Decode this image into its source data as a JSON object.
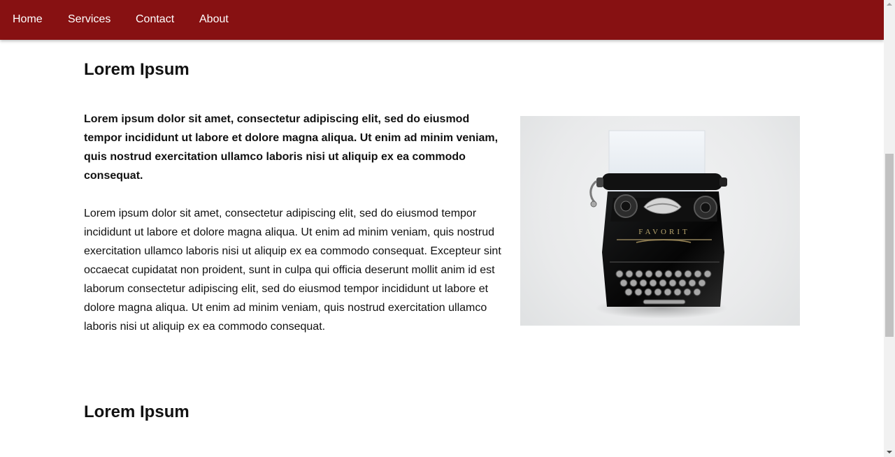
{
  "nav": {
    "items": [
      {
        "label": "Home"
      },
      {
        "label": "Services"
      },
      {
        "label": "Contact"
      },
      {
        "label": "About"
      }
    ],
    "background": "#871112"
  },
  "sections": [
    {
      "heading": "Lorem Ipsum",
      "intro": "Lorem ipsum dolor sit amet, consectetur adipiscing elit, sed do eiusmod tempor incididunt ut labore et dolore magna aliqua. Ut enim ad minim veniam, quis nostrud exercitation ullamco laboris nisi ut aliquip ex ea commodo consequat.",
      "body": "Lorem ipsum dolor sit amet, consectetur adipiscing elit, sed do eiusmod tempor incididunt ut labore et dolore magna aliqua. Ut enim ad minim veniam, quis nostrud exercitation ullamco laboris nisi ut aliquip ex ea commodo consequat. Excepteur sint occaecat cupidatat non proident, sunt in culpa qui officia deserunt mollit anim id est laborum consectetur adipiscing elit, sed do eiusmod tempor incididunt ut labore et dolore magna aliqua. Ut enim ad minim veniam, quis nostrud exercitation ullamco laboris nisi ut aliquip ex ea commodo consequat.",
      "image": {
        "icon": "typewriter-photo",
        "brand_text": "FAVORIT"
      }
    },
    {
      "heading": "Lorem Ipsum"
    }
  ]
}
